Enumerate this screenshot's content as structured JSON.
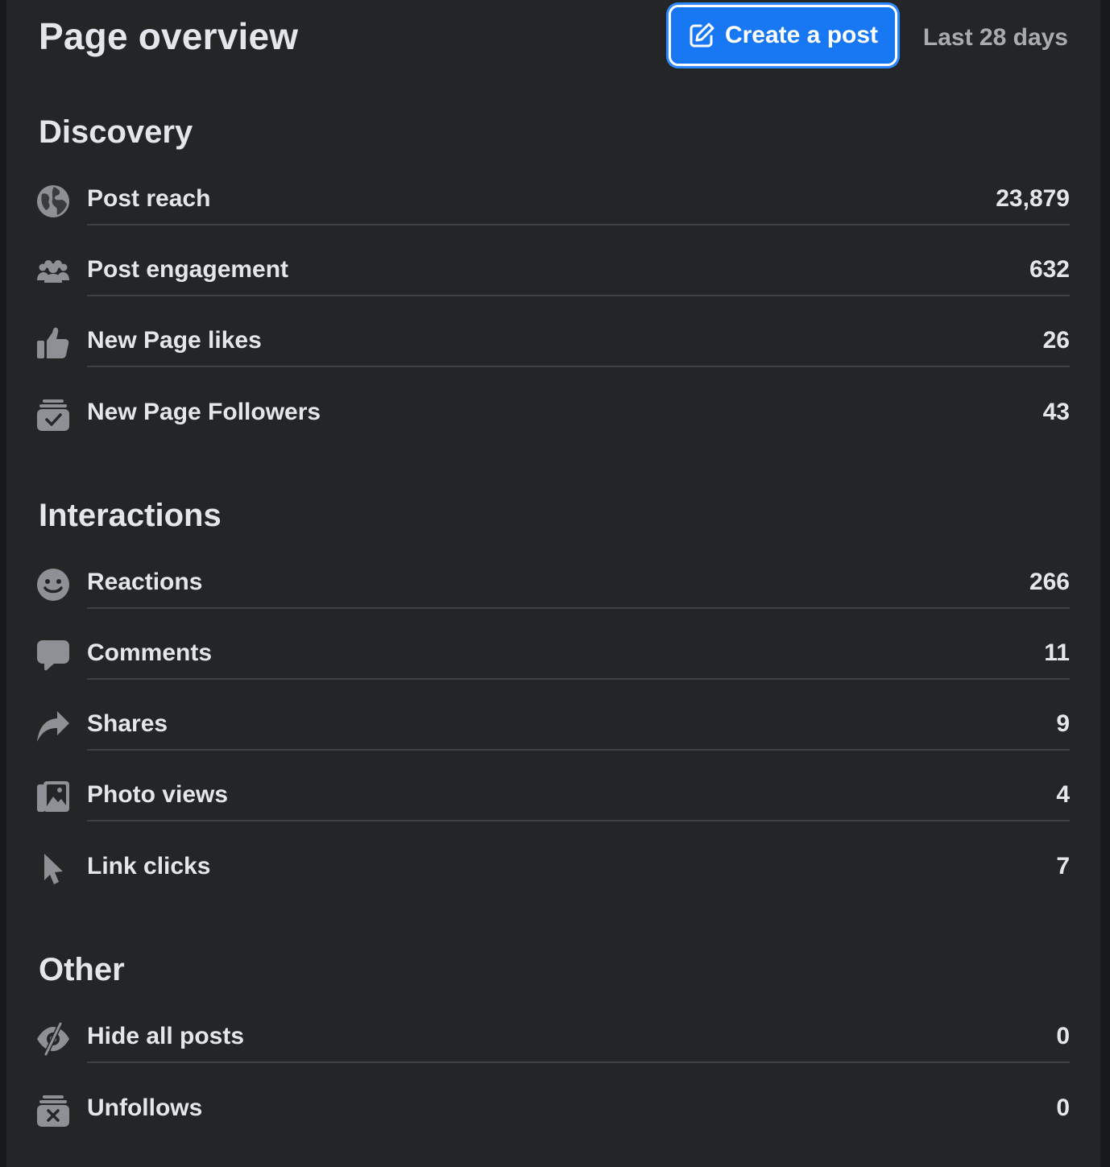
{
  "header": {
    "title": "Page overview",
    "create_button_label": "Create a post",
    "date_range": "Last 28 days",
    "accent_color": "#1877f2"
  },
  "sections": [
    {
      "title": "Discovery",
      "rows": [
        {
          "label": "Post reach",
          "value": "23,879",
          "icon": "globe-icon"
        },
        {
          "label": "Post engagement",
          "value": "632",
          "icon": "people-icon"
        },
        {
          "label": "New Page likes",
          "value": "26",
          "icon": "thumbs-up-icon"
        },
        {
          "label": "New Page Followers",
          "value": "43",
          "icon": "inbox-check-icon"
        }
      ]
    },
    {
      "title": "Interactions",
      "rows": [
        {
          "label": "Reactions",
          "value": "266",
          "icon": "smiley-icon"
        },
        {
          "label": "Comments",
          "value": "11",
          "icon": "comment-bubble-icon"
        },
        {
          "label": "Shares",
          "value": "9",
          "icon": "share-arrow-icon"
        },
        {
          "label": "Photo views",
          "value": "4",
          "icon": "photos-icon"
        },
        {
          "label": "Link clicks",
          "value": "7",
          "icon": "cursor-icon"
        }
      ]
    },
    {
      "title": "Other",
      "rows": [
        {
          "label": "Hide all posts",
          "value": "0",
          "icon": "eye-slash-icon"
        },
        {
          "label": "Unfollows",
          "value": "0",
          "icon": "inbox-x-icon"
        }
      ]
    }
  ]
}
